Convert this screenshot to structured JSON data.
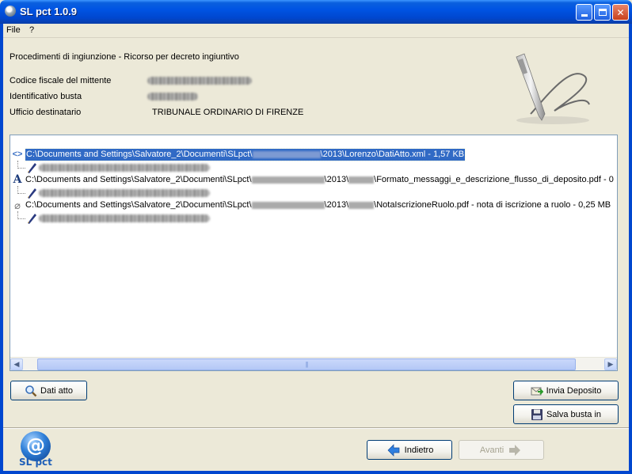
{
  "window": {
    "title": "SL pct 1.0.9",
    "minimize_glyph": "minimize",
    "maximize_glyph": "maximize",
    "close_glyph": "✕"
  },
  "menu": {
    "items": [
      {
        "label": "File"
      },
      {
        "label": "?"
      }
    ]
  },
  "header": {
    "procedure": "Procedimenti di ingiunzione - Ricorso per decreto ingiuntivo",
    "fields": [
      {
        "label": "Codice fiscale del mittente",
        "value": ""
      },
      {
        "label": "Identificativo busta",
        "value": ""
      },
      {
        "label": "Ufficio destinatario",
        "value": "TRIBUNALE ORDINARIO DI FIRENZE"
      }
    ]
  },
  "files": [
    {
      "icon": "xml-code-icon",
      "path_prefix": "C:\\Documents and Settings\\Salvatore_2\\Documenti\\SLpct\\",
      "path_suffix": "\\2013\\Lorenzo\\DatiAtto.xml - 1,57 KB",
      "selected": true
    },
    {
      "icon": "font-a-icon",
      "path_prefix": "C:\\Documents and Settings\\Salvatore_2\\Documenti\\SLpct\\",
      "path_suffix": "\\2013\\",
      "path_tail": "\\Formato_messaggi_e_descrizione_flusso_di_deposito.pdf - 0",
      "selected": false
    },
    {
      "icon": "paperclip-icon",
      "path_prefix": "C:\\Documents and Settings\\Salvatore_2\\Documenti\\SLpct\\",
      "path_suffix": "\\2013\\",
      "path_tail": "\\NotaIscrizioneRuolo.pdf - nota di iscrizione a ruolo - 0,25 MB",
      "selected": false
    }
  ],
  "scrollbar": {
    "left_arrow": "◀",
    "right_arrow": "▶",
    "grip": "|||"
  },
  "buttons": {
    "dati_atto": "Dati atto",
    "invia_deposito": "Invia Deposito",
    "salva_busta": "Salva busta in",
    "indietro": "Indietro",
    "avanti": "Avanti"
  },
  "logo": {
    "symbol": "@",
    "text": "SL pct"
  },
  "colors": {
    "titlebar": "#0054e3",
    "selection": "#316ac5",
    "frame": "#0047cf"
  }
}
